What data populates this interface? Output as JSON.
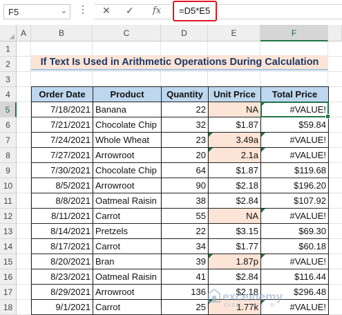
{
  "formula_bar": {
    "name_box": "F5",
    "cancel_icon": "x-icon",
    "enter_icon": "check-icon",
    "fx_label": "fx",
    "formula": "=D5*E5"
  },
  "columns": [
    "A",
    "B",
    "C",
    "D",
    "E",
    "F"
  ],
  "rows": [
    "1",
    "2",
    "3",
    "4",
    "5",
    "6",
    "7",
    "8",
    "9",
    "10",
    "11",
    "12",
    "13",
    "14",
    "15",
    "16",
    "17",
    "18"
  ],
  "selected_cell": "F5",
  "title": "If Text Is Used in Arithmetic Operations During Calculation",
  "table": {
    "headers": [
      "Order Date",
      "Product",
      "Quantity",
      "Unit Price",
      "Total Price"
    ],
    "rows": [
      {
        "date": "7/18/2021",
        "product": "Banana",
        "qty": "22",
        "unit": "NA",
        "total": "#VALUE!",
        "unit_text": true
      },
      {
        "date": "7/21/2021",
        "product": "Chocolate Chip",
        "qty": "32",
        "unit": "$1.87",
        "total": "$59.84",
        "unit_text": false
      },
      {
        "date": "7/24/2021",
        "product": "Whole Wheat",
        "qty": "23",
        "unit": "3.49a",
        "total": "#VALUE!",
        "unit_text": true
      },
      {
        "date": "7/27/2021",
        "product": "Arrowroot",
        "qty": "20",
        "unit": "2.1a",
        "total": "#VALUE!",
        "unit_text": true
      },
      {
        "date": "7/30/2021",
        "product": "Chocolate Chip",
        "qty": "64",
        "unit": "$1.87",
        "total": "$119.68",
        "unit_text": false
      },
      {
        "date": "8/5/2021",
        "product": "Arrowroot",
        "qty": "90",
        "unit": "$2.18",
        "total": "$196.20",
        "unit_text": false
      },
      {
        "date": "8/8/2021",
        "product": "Oatmeal Raisin",
        "qty": "38",
        "unit": "$2.84",
        "total": "$107.92",
        "unit_text": false
      },
      {
        "date": "8/11/2021",
        "product": "Carrot",
        "qty": "55",
        "unit": "NA",
        "total": "#VALUE!",
        "unit_text": true
      },
      {
        "date": "8/14/2021",
        "product": "Pretzels",
        "qty": "22",
        "unit": "$3.15",
        "total": "$69.30",
        "unit_text": false
      },
      {
        "date": "8/17/2021",
        "product": "Carrot",
        "qty": "34",
        "unit": "$1.77",
        "total": "$60.18",
        "unit_text": false
      },
      {
        "date": "8/20/2021",
        "product": "Bran",
        "qty": "39",
        "unit": "1.87p",
        "total": "#VALUE!",
        "unit_text": true
      },
      {
        "date": "8/23/2021",
        "product": "Oatmeal Raisin",
        "qty": "41",
        "unit": "$2.84",
        "total": "$116.44",
        "unit_text": false
      },
      {
        "date": "8/29/2021",
        "product": "Arrowroot",
        "qty": "136",
        "unit": "$2.18",
        "total": "$296.48",
        "unit_text": false
      },
      {
        "date": "9/1/2021",
        "product": "Carrot",
        "qty": "25",
        "unit": "1.77k",
        "total": "#VALUE!",
        "unit_text": true
      }
    ]
  },
  "watermark": {
    "name": "exceldemy",
    "tagline": "EXCEL · DATA · BI"
  },
  "colors": {
    "header_fill": "#bdd7ee",
    "text_value_fill": "#fce4d6",
    "selection": "#217346",
    "formula_highlight": "#e0141e"
  }
}
